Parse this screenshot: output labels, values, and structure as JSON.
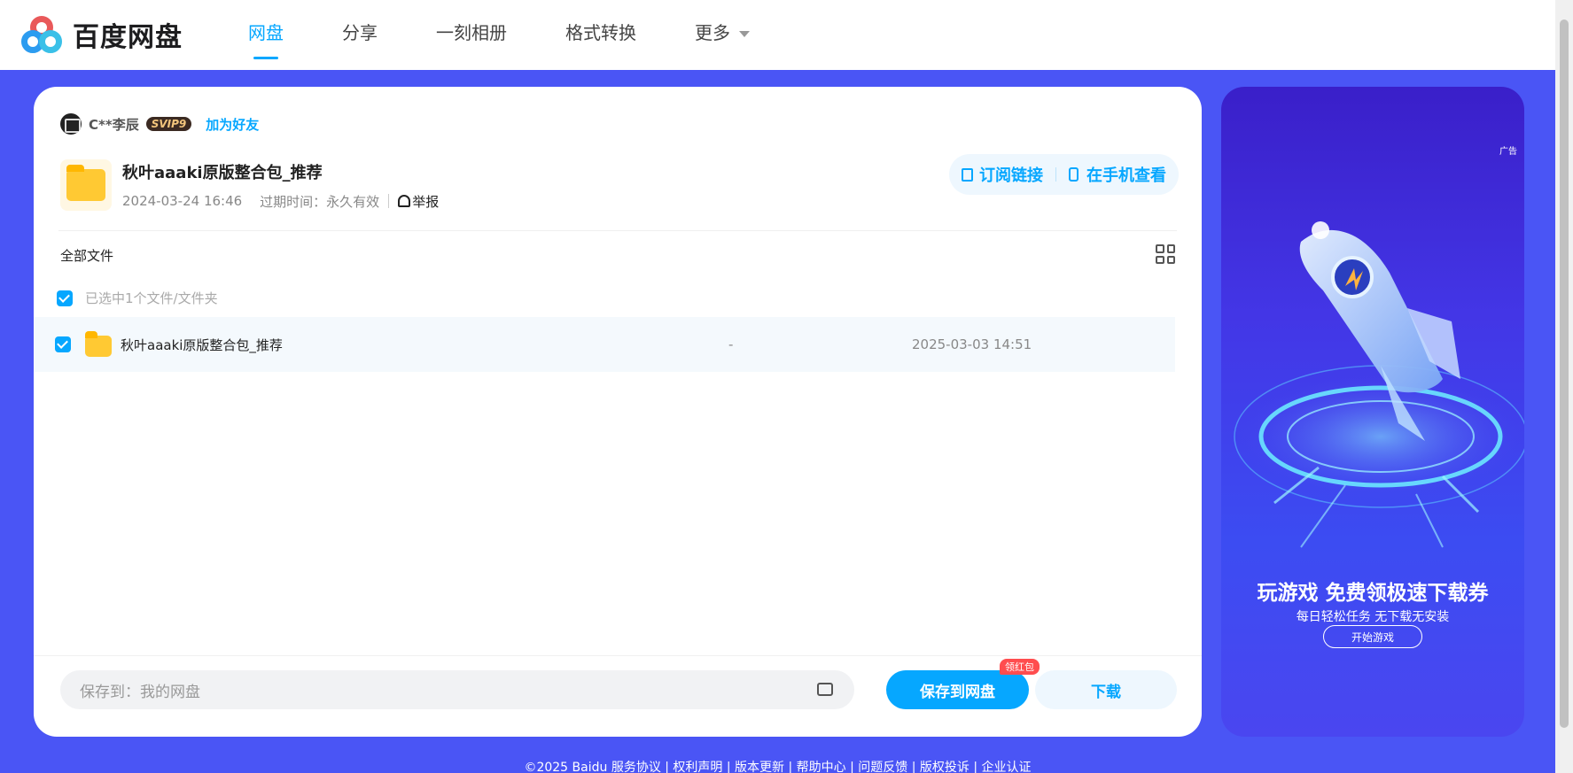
{
  "header": {
    "logo_text": "百度网盘",
    "nav": [
      {
        "label": "网盘",
        "active": true
      },
      {
        "label": "分享",
        "active": false
      },
      {
        "label": "一刻相册",
        "active": false
      },
      {
        "label": "格式转换",
        "active": false
      },
      {
        "label": "更多",
        "active": false
      }
    ]
  },
  "owner": {
    "name": "C**李辰",
    "vip_badge": "SVIP9",
    "add_friend": "加为好友"
  },
  "share": {
    "title": "秋叶aaaki原版整合包_推荐",
    "created": "2024-03-24 16:46",
    "expire": "过期时间：永久有效",
    "report": "举报",
    "subscribe": "订阅链接",
    "view_on_phone": "在手机查看"
  },
  "files": {
    "breadcrumb": "全部文件",
    "selected_text": "已选中1个文件/文件夹",
    "rows": [
      {
        "name": "秋叶aaaki原版整合包_推荐",
        "size": "-",
        "date": "2025-03-03 14:51",
        "checked": true
      }
    ]
  },
  "bottom": {
    "save_to": "保存到：我的网盘",
    "save_button": "保存到网盘",
    "badge": "领红包",
    "download_button": "下载"
  },
  "ad": {
    "tag": "广告",
    "title": "玩游戏 免费领极速下载券",
    "subtitle": "每日轻松任务 无下载无安装",
    "button": "开始游戏"
  },
  "footer": "©2025 Baidu  服务协议 | 权利声明 | 版本更新 | 帮助中心 | 问题反馈 | 版权投诉 | 企业认证",
  "colors": {
    "accent": "#06a7ff",
    "background": "#4a55f5"
  }
}
